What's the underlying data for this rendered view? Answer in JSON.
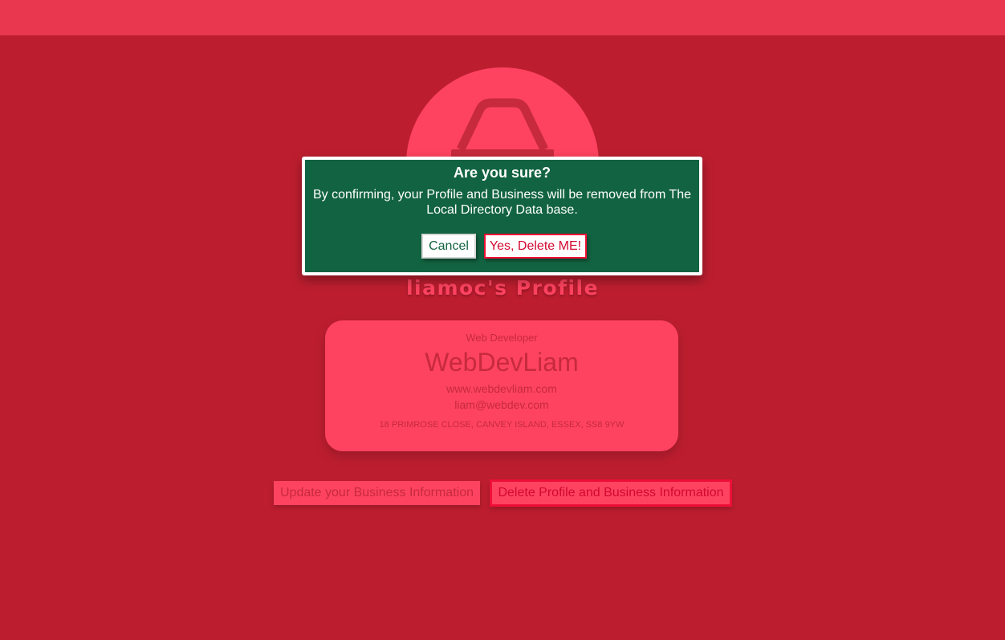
{
  "colors": {
    "page_background": "#bd1e2f",
    "header_background": "#e8374f",
    "accent_pink": "#fe4360",
    "modal_green": "#126341",
    "danger_red": "#ee0f38"
  },
  "avatar": {
    "icon": "shopping-basket-icon"
  },
  "profile": {
    "title": "liamoc's Profile"
  },
  "card": {
    "category": "Web Developer",
    "business_name": "WebDevLiam",
    "website": "www.webdevliam.com",
    "email": "liam@webdev.com",
    "address": "18 PRIMROSE CLOSE, CANVEY ISLAND, ESSEX, SS8 9YW"
  },
  "actions": {
    "update_label": "Update your Business Information",
    "delete_label": "Delete Profile and Business Information"
  },
  "modal": {
    "title": "Are you sure?",
    "message": "By confirming, your Profile and Business will be removed from The Local Directory Data base.",
    "cancel_label": "Cancel",
    "confirm_label": "Yes, Delete ME!"
  }
}
